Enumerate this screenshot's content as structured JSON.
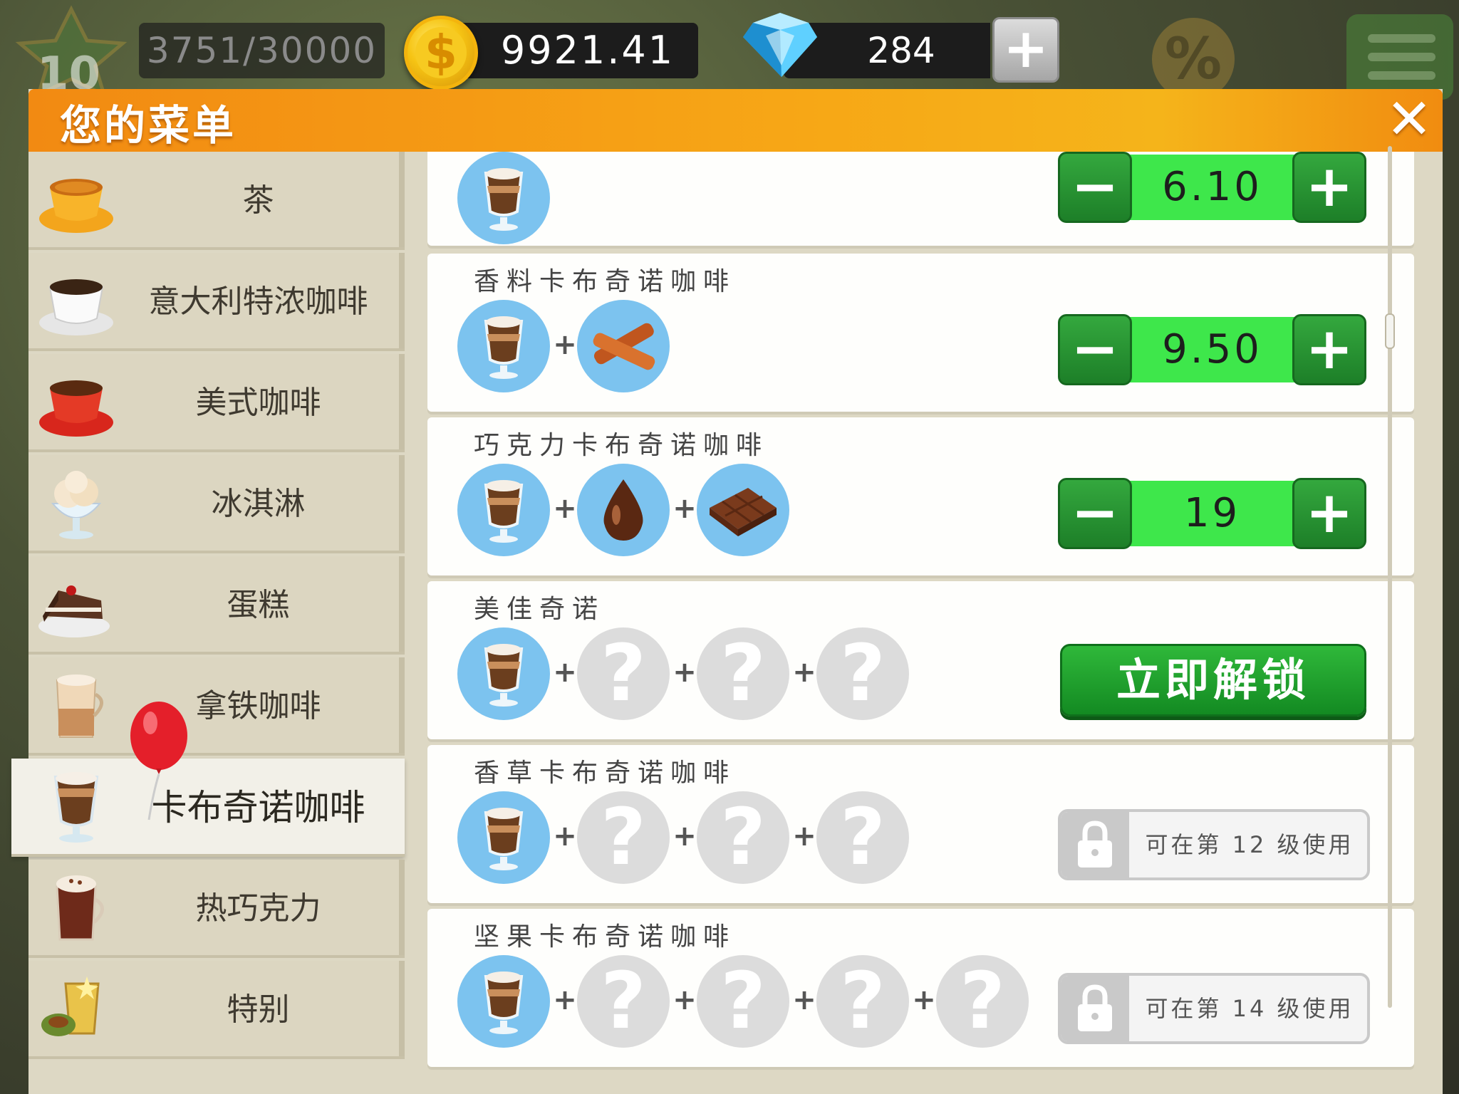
{
  "hud": {
    "level": "10",
    "xp": "3751/30000",
    "coins": "9921.41",
    "gems": "284",
    "add_gems_label": "+"
  },
  "panel": {
    "title": "您的菜单",
    "close_label": "✕"
  },
  "sidebar": {
    "items": [
      {
        "label": "茶",
        "icon": "tea-cup-icon"
      },
      {
        "label": "意大利特浓咖啡",
        "icon": "espresso-cup-icon"
      },
      {
        "label": "美式咖啡",
        "icon": "american-coffee-icon"
      },
      {
        "label": "冰淇淋",
        "icon": "ice-cream-icon"
      },
      {
        "label": "蛋糕",
        "icon": "cake-icon"
      },
      {
        "label": "拿铁咖啡",
        "icon": "latte-icon"
      },
      {
        "label": "卡布奇诺咖啡",
        "icon": "cappuccino-icon",
        "active": true
      },
      {
        "label": "热巧克力",
        "icon": "hot-chocolate-icon"
      },
      {
        "label": "特别",
        "icon": "special-icon"
      }
    ]
  },
  "recipes": [
    {
      "title": "",
      "ingredients": [
        "cappuccino"
      ],
      "price": "6.10",
      "state": "priced"
    },
    {
      "title": "香料卡布奇诺咖啡",
      "ingredients": [
        "cappuccino",
        "cinnamon"
      ],
      "price": "9.50",
      "state": "priced"
    },
    {
      "title": "巧克力卡布奇诺咖啡",
      "ingredients": [
        "cappuccino",
        "chocolate-syrup",
        "chocolate-bar"
      ],
      "price": "19",
      "state": "priced"
    },
    {
      "title": "美佳奇诺",
      "ingredients": [
        "cappuccino",
        "unknown",
        "unknown",
        "unknown"
      ],
      "state": "unlock",
      "unlock_label": "立即解锁"
    },
    {
      "title": "香草卡布奇诺咖啡",
      "ingredients": [
        "cappuccino",
        "unknown",
        "unknown",
        "unknown"
      ],
      "state": "locked",
      "lock_text": "可在第 12 级使用"
    },
    {
      "title": "坚果卡布奇诺咖啡",
      "ingredients": [
        "cappuccino",
        "unknown",
        "unknown",
        "unknown",
        "unknown"
      ],
      "state": "locked",
      "lock_text": "可在第 14 级使用"
    }
  ],
  "ui": {
    "minus_label": "−",
    "plus_label": "+",
    "ingredient_separator": "+",
    "unknown_label": "?"
  },
  "colors": {
    "header_orange": "#f28a12",
    "price_green": "#3ee74b",
    "button_green": "#1d7f28",
    "ingredient_blue": "#7cc3ef"
  }
}
